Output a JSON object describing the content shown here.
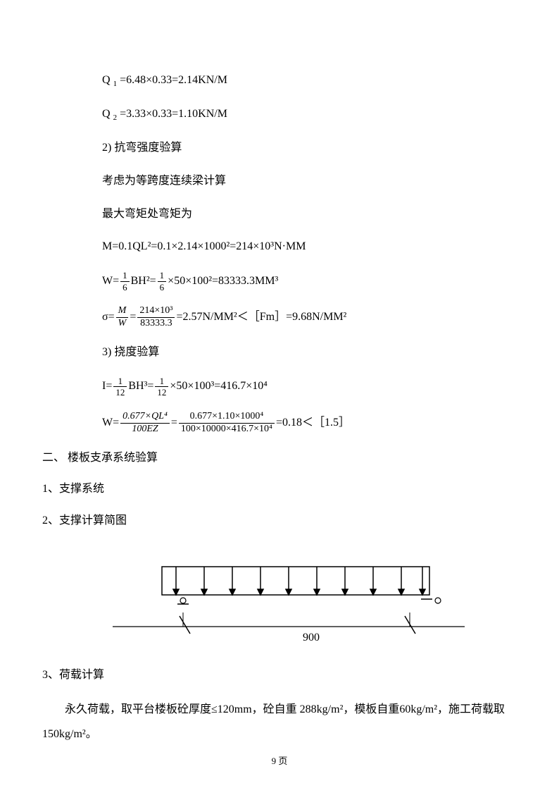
{
  "lines": {
    "q1": "Q",
    "q1sub": "1",
    "q1rest": "=6.48×0.33=2.14KN/M",
    "q2": "Q",
    "q2sub": "2",
    "q2rest": "=3.33×0.33=1.10KN/M",
    "h2": "2) 抗弯强度验算",
    "h2a": "考虑为等跨度连续梁计算",
    "h2b": "最大弯矩处弯矩为",
    "m_eq": "M=0.1QL²=0.1×2.14×1000²=214×10³N·MM",
    "w_pre": "W=",
    "w_frac1_num": "1",
    "w_frac1_den": "6",
    "w_mid": "BH²=",
    "w_frac2_num": "1",
    "w_frac2_den": "6",
    "w_rest": "×50×100²=83333.3MM³",
    "sigma": "σ=",
    "sigma_f1_num": "M",
    "sigma_f1_den": "W",
    "sigma_eq": "=",
    "sigma_f2_num": "214×10³",
    "sigma_f2_den": "83333.3",
    "sigma_rest": "=2.57N/MM²＜［Fm］=9.68N/MM²",
    "h3": "3) 挠度验算",
    "i_pre": "I=",
    "i_f1_num": "1",
    "i_f1_den": "12",
    "i_mid": "BH³=",
    "i_f2_num": "1",
    "i_f2_den": "12",
    "i_rest": "×50×100³=416.7×10⁴",
    "wd_pre": "W=",
    "wd_f1_num": "0.677×QL⁴",
    "wd_f1_den": "100EZ",
    "wd_eq": "=",
    "wd_f2_num": "0.677×1.10×1000⁴",
    "wd_f2_den": "100×10000×416.7×10⁴",
    "wd_rest": "=0.18＜［1.5］",
    "sec2": "二、 楼板支承系统验算",
    "sec2_1": "1、支撑系统",
    "sec2_2": "2、支撑计算简图",
    "dim": "900",
    "sec2_3": "3、荷载计算",
    "para": "永久荷载，取平台楼板砼厚度≤120mm，砼自重 288kg/m²，模板自重60kg/m²，施工荷载取 150kg/m²。",
    "pagenum": "9 页"
  }
}
